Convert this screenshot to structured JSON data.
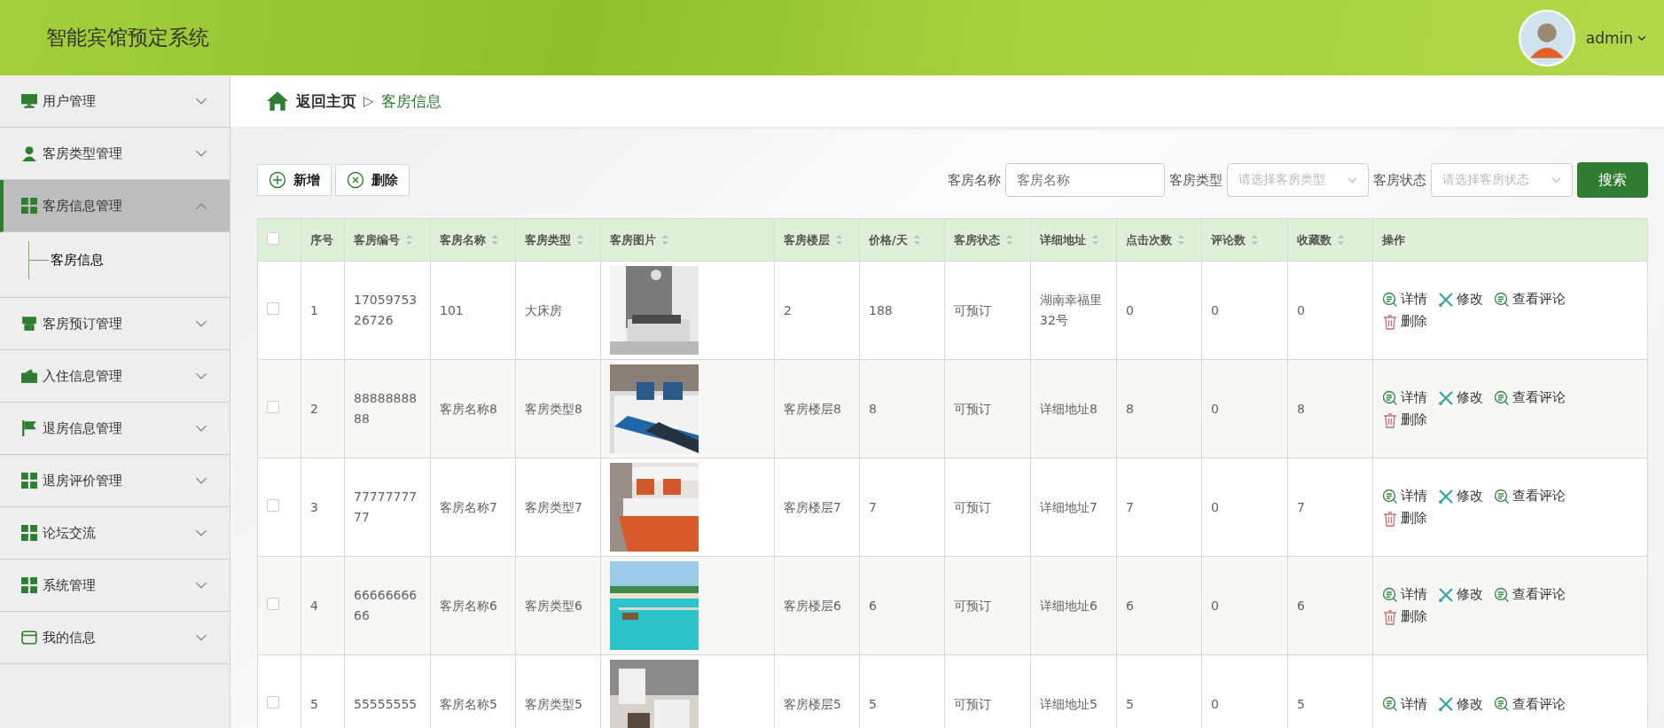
{
  "header": {
    "title": "智能宾馆预定系统",
    "user": "admin"
  },
  "sidebar": {
    "items": [
      {
        "label": "用户管理",
        "kind": "monitor",
        "expanded": false,
        "selected": false
      },
      {
        "label": "客房类型管理",
        "kind": "person",
        "expanded": false,
        "selected": false
      },
      {
        "label": "客房信息管理",
        "kind": "grid",
        "expanded": true,
        "selected": true,
        "children": [
          {
            "label": "客房信息",
            "selected": true
          }
        ]
      },
      {
        "label": "客房预订管理",
        "kind": "store",
        "expanded": false,
        "selected": false
      },
      {
        "label": "入住信息管理",
        "kind": "wallet",
        "expanded": false,
        "selected": false
      },
      {
        "label": "退房信息管理",
        "kind": "flag",
        "expanded": false,
        "selected": false
      },
      {
        "label": "退房评价管理",
        "kind": "grid",
        "expanded": false,
        "selected": false
      },
      {
        "label": "论坛交流",
        "kind": "grid",
        "expanded": false,
        "selected": false
      },
      {
        "label": "系统管理",
        "kind": "grid",
        "expanded": false,
        "selected": false
      },
      {
        "label": "我的信息",
        "kind": "card",
        "expanded": false,
        "selected": false
      }
    ]
  },
  "breadcrumb": {
    "home": "返回主页",
    "separator": "▷",
    "current": "客房信息"
  },
  "toolbar": {
    "buttons": [
      {
        "label": "新增",
        "kind": "add"
      },
      {
        "label": "删除",
        "kind": "delete"
      }
    ],
    "filters": [
      {
        "label": "客房名称",
        "placeholder": "客房名称",
        "kind": "input"
      },
      {
        "label": "客房类型",
        "placeholder": "请选择客房类型",
        "kind": "select"
      },
      {
        "label": "客房状态",
        "placeholder": "请选择客房状态",
        "kind": "select"
      }
    ],
    "search_button": "搜索"
  },
  "table": {
    "select_all": {
      "checked": false
    },
    "columns": [
      {
        "label": "序号",
        "sortable": false,
        "kind": "text"
      },
      {
        "label": "客房编号",
        "sortable": true,
        "kind": "text"
      },
      {
        "label": "客房名称",
        "sortable": true,
        "kind": "text"
      },
      {
        "label": "客房类型",
        "sortable": true,
        "kind": "text"
      },
      {
        "label": "客房图片",
        "sortable": true,
        "kind": "picture"
      },
      {
        "label": "客房楼层",
        "sortable": true,
        "kind": "text"
      },
      {
        "label": "价格/天",
        "sortable": true,
        "kind": "text"
      },
      {
        "label": "客房状态",
        "sortable": true,
        "kind": "text"
      },
      {
        "label": "详细地址",
        "sortable": true,
        "kind": "text"
      },
      {
        "label": "点击次数",
        "sortable": true,
        "kind": "text"
      },
      {
        "label": "评论数",
        "sortable": true,
        "kind": "text"
      },
      {
        "label": "收藏数",
        "sortable": true,
        "kind": "text"
      },
      {
        "label": "操作",
        "sortable": false,
        "kind": "actions"
      }
    ],
    "rows": [
      {
        "checked": false,
        "cells": [
          "1",
          "1705975326726",
          "101",
          "大床房",
          "",
          "2",
          "188",
          "可预订",
          "湖南幸福里32号",
          "0",
          "0",
          "0"
        ],
        "actions": [
          {
            "label": "详情",
            "kind": "detail"
          },
          {
            "label": "修改",
            "kind": "edit"
          },
          {
            "label": "查看评论",
            "kind": "detail"
          },
          {
            "label": "删除",
            "kind": "delete"
          }
        ]
      },
      {
        "checked": false,
        "cells": [
          "2",
          "8888888888",
          "客房名称8",
          "客房类型8",
          "",
          "客房楼层8",
          "8",
          "可预订",
          "详细地址8",
          "8",
          "0",
          "8"
        ],
        "actions": [
          {
            "label": "详情",
            "kind": "detail"
          },
          {
            "label": "修改",
            "kind": "edit"
          },
          {
            "label": "查看评论",
            "kind": "detail"
          },
          {
            "label": "删除",
            "kind": "delete"
          }
        ]
      },
      {
        "checked": false,
        "cells": [
          "3",
          "7777777777",
          "客房名称7",
          "客房类型7",
          "",
          "客房楼层7",
          "7",
          "可预订",
          "详细地址7",
          "7",
          "0",
          "7"
        ],
        "actions": [
          {
            "label": "详情",
            "kind": "detail"
          },
          {
            "label": "修改",
            "kind": "edit"
          },
          {
            "label": "查看评论",
            "kind": "detail"
          },
          {
            "label": "删除",
            "kind": "delete"
          }
        ]
      },
      {
        "checked": false,
        "cells": [
          "4",
          "6666666666",
          "客房名称6",
          "客房类型6",
          "",
          "客房楼层6",
          "6",
          "可预订",
          "详细地址6",
          "6",
          "0",
          "6"
        ],
        "actions": [
          {
            "label": "详情",
            "kind": "detail"
          },
          {
            "label": "修改",
            "kind": "edit"
          },
          {
            "label": "查看评论",
            "kind": "detail"
          },
          {
            "label": "删除",
            "kind": "delete"
          }
        ]
      },
      {
        "checked": false,
        "cells": [
          "5",
          "55555555",
          "客房名称5",
          "客房类型5",
          "",
          "客房楼层5",
          "5",
          "可预订",
          "详细地址5",
          "5",
          "0",
          "5"
        ],
        "actions": [
          {
            "label": "详情",
            "kind": "detail"
          },
          {
            "label": "修改",
            "kind": "edit"
          },
          {
            "label": "查看评论",
            "kind": "detail"
          }
        ]
      }
    ]
  }
}
